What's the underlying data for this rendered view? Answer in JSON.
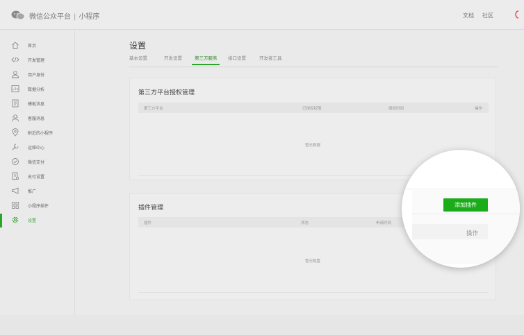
{
  "header": {
    "brand": "微信公众平台",
    "separator": "|",
    "product": "小程序",
    "links": [
      "文档",
      "社区"
    ],
    "colors": {
      "accent": "#1aad19",
      "logo": "#888888",
      "corner": "#d9534f"
    }
  },
  "sidebar": {
    "items": [
      {
        "label": "首页",
        "icon": "home-icon"
      },
      {
        "label": "开发管理",
        "icon": "code-icon"
      },
      {
        "label": "用户身份",
        "icon": "user-icon"
      },
      {
        "label": "数据分析",
        "icon": "chart-icon"
      },
      {
        "label": "模板消息",
        "icon": "document-icon"
      },
      {
        "label": "客服消息",
        "icon": "support-icon"
      },
      {
        "label": "附近的小程序",
        "icon": "location-icon"
      },
      {
        "label": "运维中心",
        "icon": "wrench-icon"
      },
      {
        "label": "微信支付",
        "icon": "payment-icon"
      },
      {
        "label": "支付设置",
        "icon": "receipt-icon"
      },
      {
        "label": "推广",
        "icon": "megaphone-icon"
      },
      {
        "label": "小程序插件",
        "icon": "plugin-grid-icon"
      },
      {
        "label": "设置",
        "icon": "gear-icon"
      }
    ],
    "active_index": 12
  },
  "main": {
    "title": "设置",
    "tabs": [
      "基本设置",
      "开发设置",
      "第三方服务",
      "接口设置",
      "开发者工具"
    ],
    "active_tab": 2,
    "third_party": {
      "title": "第三方平台授权管理",
      "columns": [
        "第三方平台",
        "已授权权限",
        "授权时间",
        "操作"
      ],
      "empty_text": "暂无数据"
    },
    "plugins": {
      "title": "插件管理",
      "columns": [
        "插件",
        "状态",
        "申请时间",
        "操作"
      ],
      "empty_text": "暂无配置",
      "add_button": "添加插件",
      "operation_label": "操作"
    }
  }
}
